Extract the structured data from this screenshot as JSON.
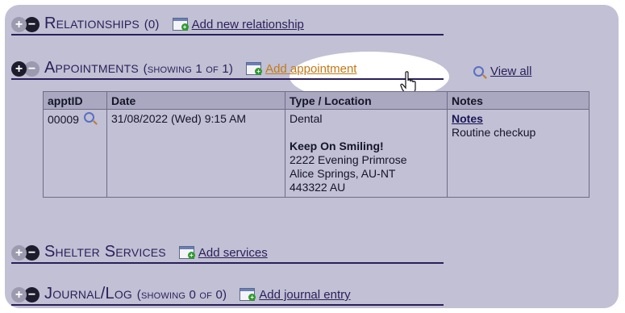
{
  "relationships": {
    "title": "Relationships",
    "count": "(0)",
    "add_label": "Add new relationship"
  },
  "appointments": {
    "title": "Appointments",
    "count": "(showing 1 of 1)",
    "add_label": "Add appointment",
    "view_all_label": "View all",
    "columns": [
      "apptID",
      "Date",
      "Type / Location",
      "Notes"
    ],
    "rows": [
      {
        "appt_id": "00009",
        "date": "31/08/2022 (Wed) 9:15 AM",
        "type": "Dental",
        "location_name": "Keep On Smiling!",
        "address_line1": "2222 Evening Primrose",
        "address_line2": "Alice Springs, AU-NT",
        "address_line3": "443322 AU",
        "notes_link": "Notes",
        "notes_text": "Routine checkup"
      }
    ]
  },
  "shelter_services": {
    "title": "Shelter Services",
    "add_label": "Add services"
  },
  "journal": {
    "title": "Journal/Log",
    "count": "(showing 0 of 0)",
    "add_label": "Add journal entry"
  },
  "icons": {
    "expand": "plus-circle-icon",
    "collapse": "minus-circle-icon",
    "add": "calendar-add-icon",
    "search": "magnifier-icon",
    "pointer": "hand-pointer-cursor-icon"
  },
  "colors": {
    "panel": "#c1c0d4",
    "heading": "#2a1f5a",
    "link_highlight": "#c27a18",
    "table_header": "#a9a8c0"
  }
}
